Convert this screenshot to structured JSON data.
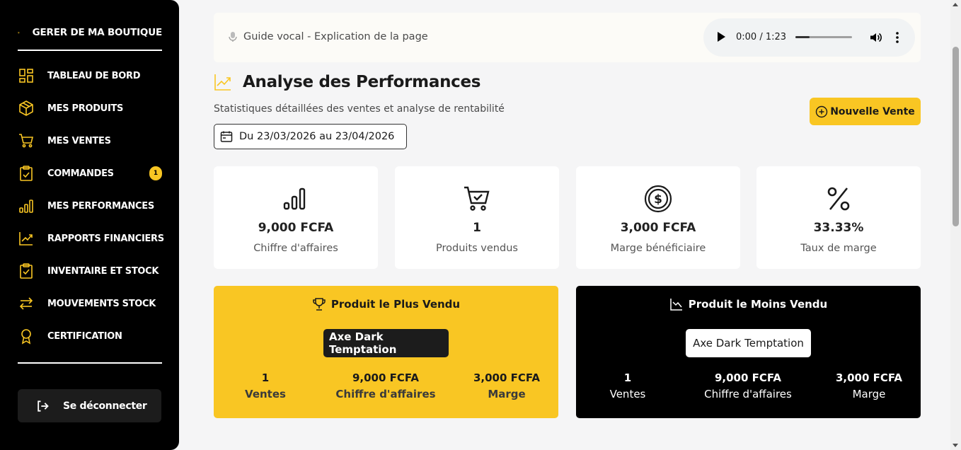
{
  "sidebar": {
    "brand": "GERER DE MA BOUTIQUE",
    "items": [
      {
        "label": "TABLEAU DE BORD",
        "icon": "dashboard-icon"
      },
      {
        "label": "MES PRODUITS",
        "icon": "box-icon"
      },
      {
        "label": "MES VENTES",
        "icon": "cart-icon"
      },
      {
        "label": "COMMANDES",
        "icon": "clipboard-check-icon",
        "badge": "1"
      },
      {
        "label": "MES PERFORMANCES",
        "icon": "bar-chart-icon"
      },
      {
        "label": "RAPPORTS FINANCIERS",
        "icon": "trend-chart-icon"
      },
      {
        "label": "INVENTAIRE ET STOCK",
        "icon": "clipboard-icon"
      },
      {
        "label": "MOUVEMENTS STOCK",
        "icon": "transfer-icon"
      },
      {
        "label": "CERTIFICATION",
        "icon": "award-icon"
      }
    ],
    "logout": "Se déconnecter",
    "accent": "#f9c623"
  },
  "audio": {
    "guide": "Guide vocal - Explication de la page",
    "time": "0:00 / 1:23",
    "progress_percent": 25
  },
  "page": {
    "title": "Analyse des Performances",
    "subtitle": "Statistiques détaillées des ventes et analyse de rentabilité",
    "date_range": "Du 23/03/2026 au 23/04/2026",
    "new_sale": "Nouvelle Vente"
  },
  "kpis": [
    {
      "value": "9,000 FCFA",
      "label": "Chiffre d'affaires",
      "icon": "bar-chart-icon"
    },
    {
      "value": "1",
      "label": "Produits vendus",
      "icon": "cart-check-icon"
    },
    {
      "value": "3,000 FCFA",
      "label": "Marge bénéficiaire",
      "icon": "dollar-coin-icon"
    },
    {
      "value": "33.33%",
      "label": "Taux de marge",
      "icon": "percent-icon"
    }
  ],
  "best": {
    "title": "Produit le Plus Vendu",
    "product": "Axe Dark Temptation",
    "stats": [
      {
        "value": "1",
        "label": "Ventes"
      },
      {
        "value": "9,000 FCFA",
        "label": "Chiffre d'affaires"
      },
      {
        "value": "3,000 FCFA",
        "label": "Marge"
      }
    ]
  },
  "worst": {
    "title": "Produit le Moins Vendu",
    "product": "Axe Dark Temptation",
    "stats": [
      {
        "value": "1",
        "label": "Ventes"
      },
      {
        "value": "9,000 FCFA",
        "label": "Chiffre d'affaires"
      },
      {
        "value": "3,000 FCFA",
        "label": "Marge"
      }
    ]
  }
}
